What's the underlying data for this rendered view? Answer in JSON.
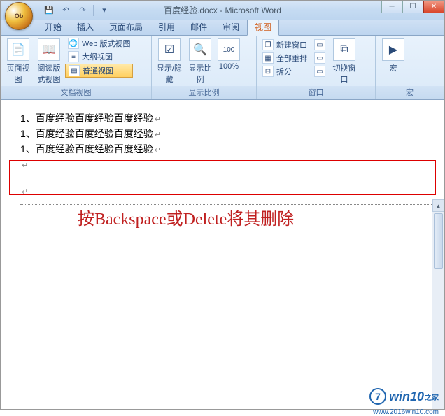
{
  "title": "百度经验.docx - Microsoft Word",
  "office_label": "Ob",
  "qat": {
    "save": "💾",
    "undo": "↶",
    "redo": "↷",
    "more": "▾"
  },
  "win": {
    "min": "─",
    "max": "☐",
    "close": "✕"
  },
  "tabs": [
    "开始",
    "插入",
    "页面布局",
    "引用",
    "邮件",
    "审阅",
    "视图"
  ],
  "active_tab": 6,
  "ribbon": {
    "g1": {
      "label": "文档视图",
      "btn1": "页面视图",
      "btn2": "阅读版式视图",
      "web": "Web 版式视图",
      "outline": "大纲视图",
      "normal": "普通视图"
    },
    "g2": {
      "label": "显示比例",
      "showhide": "显示/隐藏",
      "zoom": "显示比例",
      "hundred": "100%"
    },
    "g3": {
      "label": "窗口",
      "newwin": "新建窗口",
      "arrange": "全部重排",
      "split": "拆分",
      "switch": "切换窗口"
    },
    "g4": {
      "label": "宏",
      "macro": "宏"
    }
  },
  "doc": {
    "line1": "1、百度经验百度经验百度经验",
    "line2": "1、百度经验百度经验百度经验",
    "line3": "1、百度经验百度经验百度经验"
  },
  "hint": "按Backspace或Delete将其删除",
  "watermark": {
    "icon": "7",
    "main": "win10",
    "sub": "之家",
    "url": "www.2016win10.com"
  }
}
